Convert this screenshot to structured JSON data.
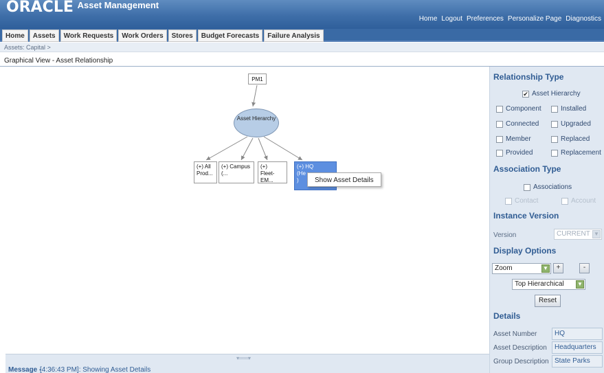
{
  "header": {
    "logo_oracle": "ORACLE",
    "logo_app": "Asset Management",
    "global_links": [
      "Home",
      "Logout",
      "Preferences",
      "Personalize Page",
      "Diagnostics"
    ]
  },
  "tabs": [
    "Home",
    "Assets",
    "Work Requests",
    "Work Orders",
    "Stores",
    "Budget Forecasts",
    "Failure Analysis"
  ],
  "breadcrumb": "Assets: Capital  >",
  "page_title": "Graphical View - Asset Relationship",
  "graph": {
    "root": "PM1",
    "center": "Asset Hierarchy",
    "children": [
      {
        "line1": "(+) All",
        "line2": "Prod..."
      },
      {
        "line1": "(+) Campus",
        "line2": "(..."
      },
      {
        "line1": "(+)",
        "line2": "Fleet-EM..."
      },
      {
        "line1": "(+) HQ",
        "line2": "(He",
        "line3": ")"
      }
    ],
    "context_menu_item": "Show Asset Details"
  },
  "panel": {
    "relationship_type_title": "Relationship Type",
    "asset_hierarchy": "Asset Hierarchy",
    "relationship_options": [
      "Component",
      "Installed",
      "Connected",
      "Upgraded",
      "Member",
      "Replaced",
      "Provided",
      "Replacement"
    ],
    "association_type_title": "Association Type",
    "associations": "Associations",
    "contact": "Contact",
    "account": "Account",
    "instance_version_title": "Instance Version",
    "version_label": "Version",
    "version_value": "CURRENT",
    "display_options_title": "Display Options",
    "zoom_value": "Zoom",
    "plus": "+",
    "minus": "-",
    "layout_value": "Top Hierarchical",
    "reset": "Reset",
    "details_title": "Details",
    "details": [
      {
        "key": "Asset Number",
        "value": "HQ"
      },
      {
        "key": "Asset Description",
        "value": "Headquarters"
      },
      {
        "key": "Group Description",
        "value": "State Parks"
      }
    ]
  },
  "message": {
    "label": "Message -",
    "text": "[4:36:43 PM]: Showing Asset Details"
  },
  "colors": {
    "header_blue": "#3e6ea8",
    "panel_bg": "#e0e8f2",
    "section_title": "#305c93",
    "selected_node": "#5d8fe0"
  }
}
